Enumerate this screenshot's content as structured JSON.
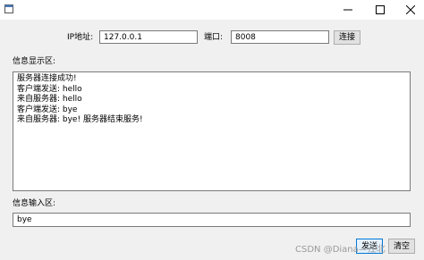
{
  "window": {
    "title": ""
  },
  "connection": {
    "ip_label": "IP地址:",
    "ip_value": "127.0.0.1",
    "port_label": "端口:",
    "port_value": "8008",
    "connect_label": "连接"
  },
  "display": {
    "label": "信息显示区:",
    "messages": [
      "服务器连接成功!",
      "客户端发送: hello",
      "来自服务器: hello",
      "客户端发送: bye",
      "来自服务器: bye! 服务器结束服务!"
    ]
  },
  "input": {
    "label": "信息输入区:",
    "value": "bye"
  },
  "actions": {
    "send_label": "发送",
    "clear_label": "清空"
  },
  "watermark": "CSDN @Diana—江北"
}
